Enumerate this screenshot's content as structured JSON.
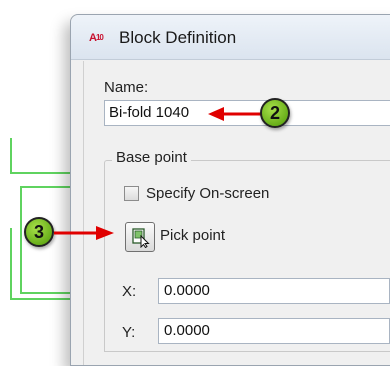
{
  "window": {
    "app_icon_text": "A",
    "app_icon_sub": "10",
    "title": "Block Definition"
  },
  "name_section": {
    "label": "Name:",
    "value": "Bi-fold 1040"
  },
  "base_point": {
    "group_title": "Base point",
    "specify_onscreen_label": "Specify On-screen",
    "specify_onscreen_checked": false,
    "pick_point_label": "Pick point",
    "x_label": "X:",
    "x_value": "0.0000",
    "y_label": "Y:",
    "y_value": "0.0000"
  },
  "callouts": {
    "name_callout": "2",
    "pick_callout": "3"
  },
  "colors": {
    "drawing_lines": "#5fd35f",
    "callout_fill": "#6fbf1f",
    "arrow": "#e00000"
  }
}
